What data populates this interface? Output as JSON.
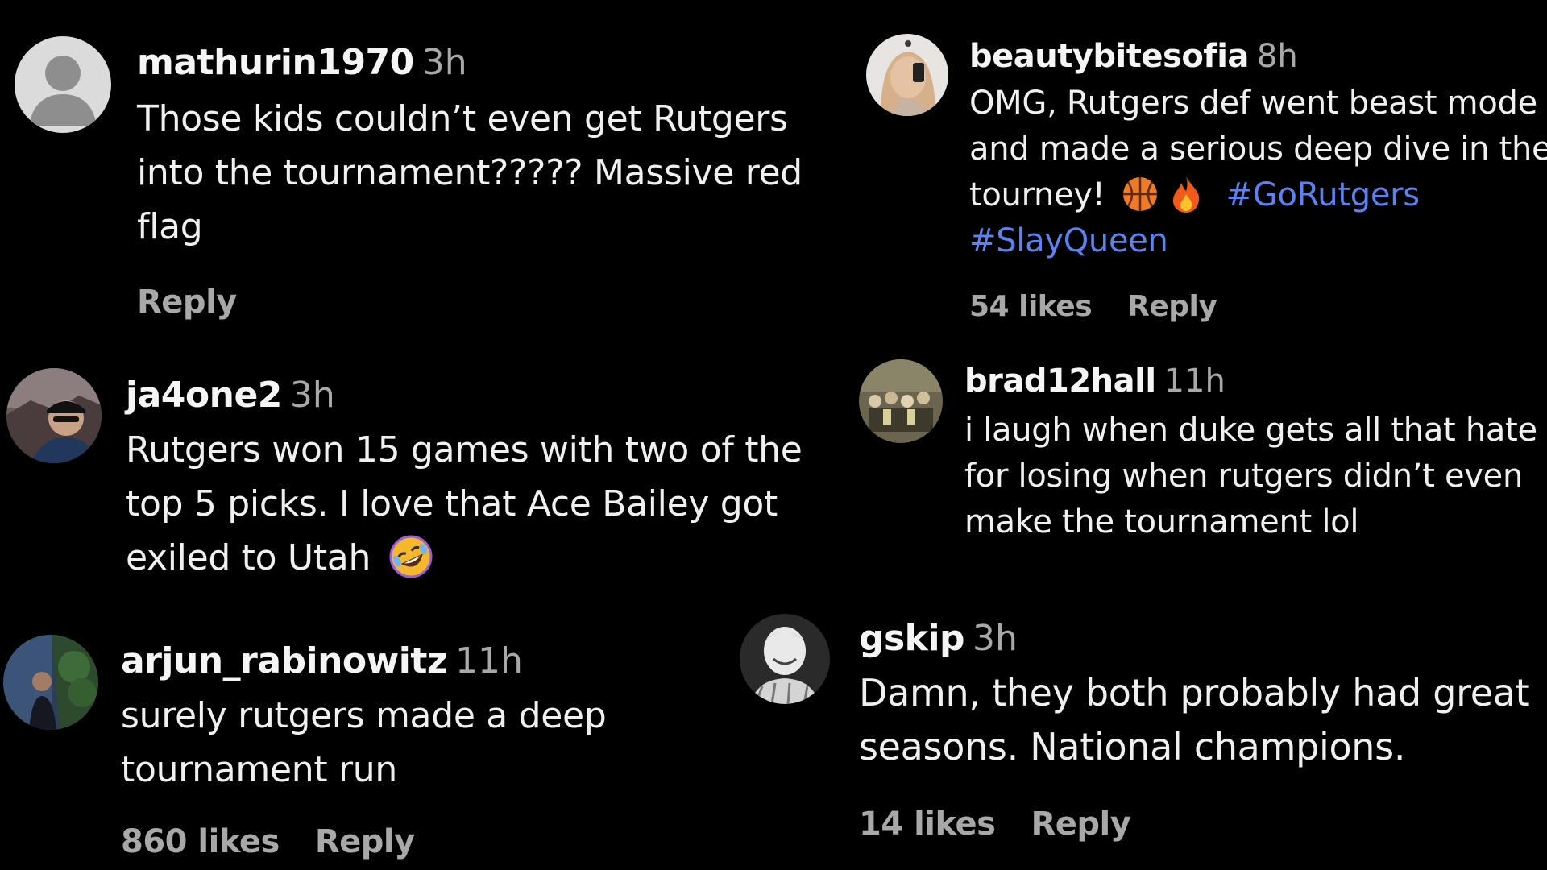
{
  "comments": [
    {
      "username": "mathurin1970",
      "time": "3h",
      "text_lines": [
        "Those kids couldn’t even get Rutgers",
        "into the tournament????? Massive red",
        "flag"
      ],
      "likes": "",
      "reply": "Reply",
      "avatar": "default-avatar-icon"
    },
    {
      "username": "ja4one2",
      "time": "3h",
      "text_lines": [
        "Rutgers won 15 games with two of the",
        "top 5 picks. I love that Ace Bailey got",
        "exiled to Utah"
      ],
      "emoji": "rolling-on-floor-laughing-emoji"
    },
    {
      "username": "arjun_rabinowitz",
      "time": "11h",
      "text_lines": [
        "surely rutgers made a deep",
        "tournament run"
      ],
      "likes": "860 likes",
      "reply": "Reply"
    },
    {
      "username": "beautybitesofia",
      "time": "8h",
      "text_lines": [
        "OMG, Rutgers def went beast mode",
        "and made a serious deep dive in the",
        "tourney!"
      ],
      "emojis": [
        "basketball-emoji",
        "fire-emoji"
      ],
      "hashtags": [
        "#GoRutgers",
        "#SlayQueen"
      ],
      "likes": "54 likes",
      "reply": "Reply"
    },
    {
      "username": "brad12hall",
      "time": "11h",
      "text_lines": [
        "i laugh when duke gets all that hate",
        "for losing when rutgers didn’t even",
        "make the tournament lol"
      ]
    },
    {
      "username": "gskip",
      "time": "3h",
      "text_lines": [
        "Damn, they both probably had great",
        "seasons. National champions."
      ],
      "likes": "14 likes",
      "reply": "Reply"
    }
  ],
  "colors": {
    "background": "#000000",
    "text": "#f0f0f0",
    "secondary": "#a8a8a8",
    "hashtag": "#5a82f0"
  }
}
